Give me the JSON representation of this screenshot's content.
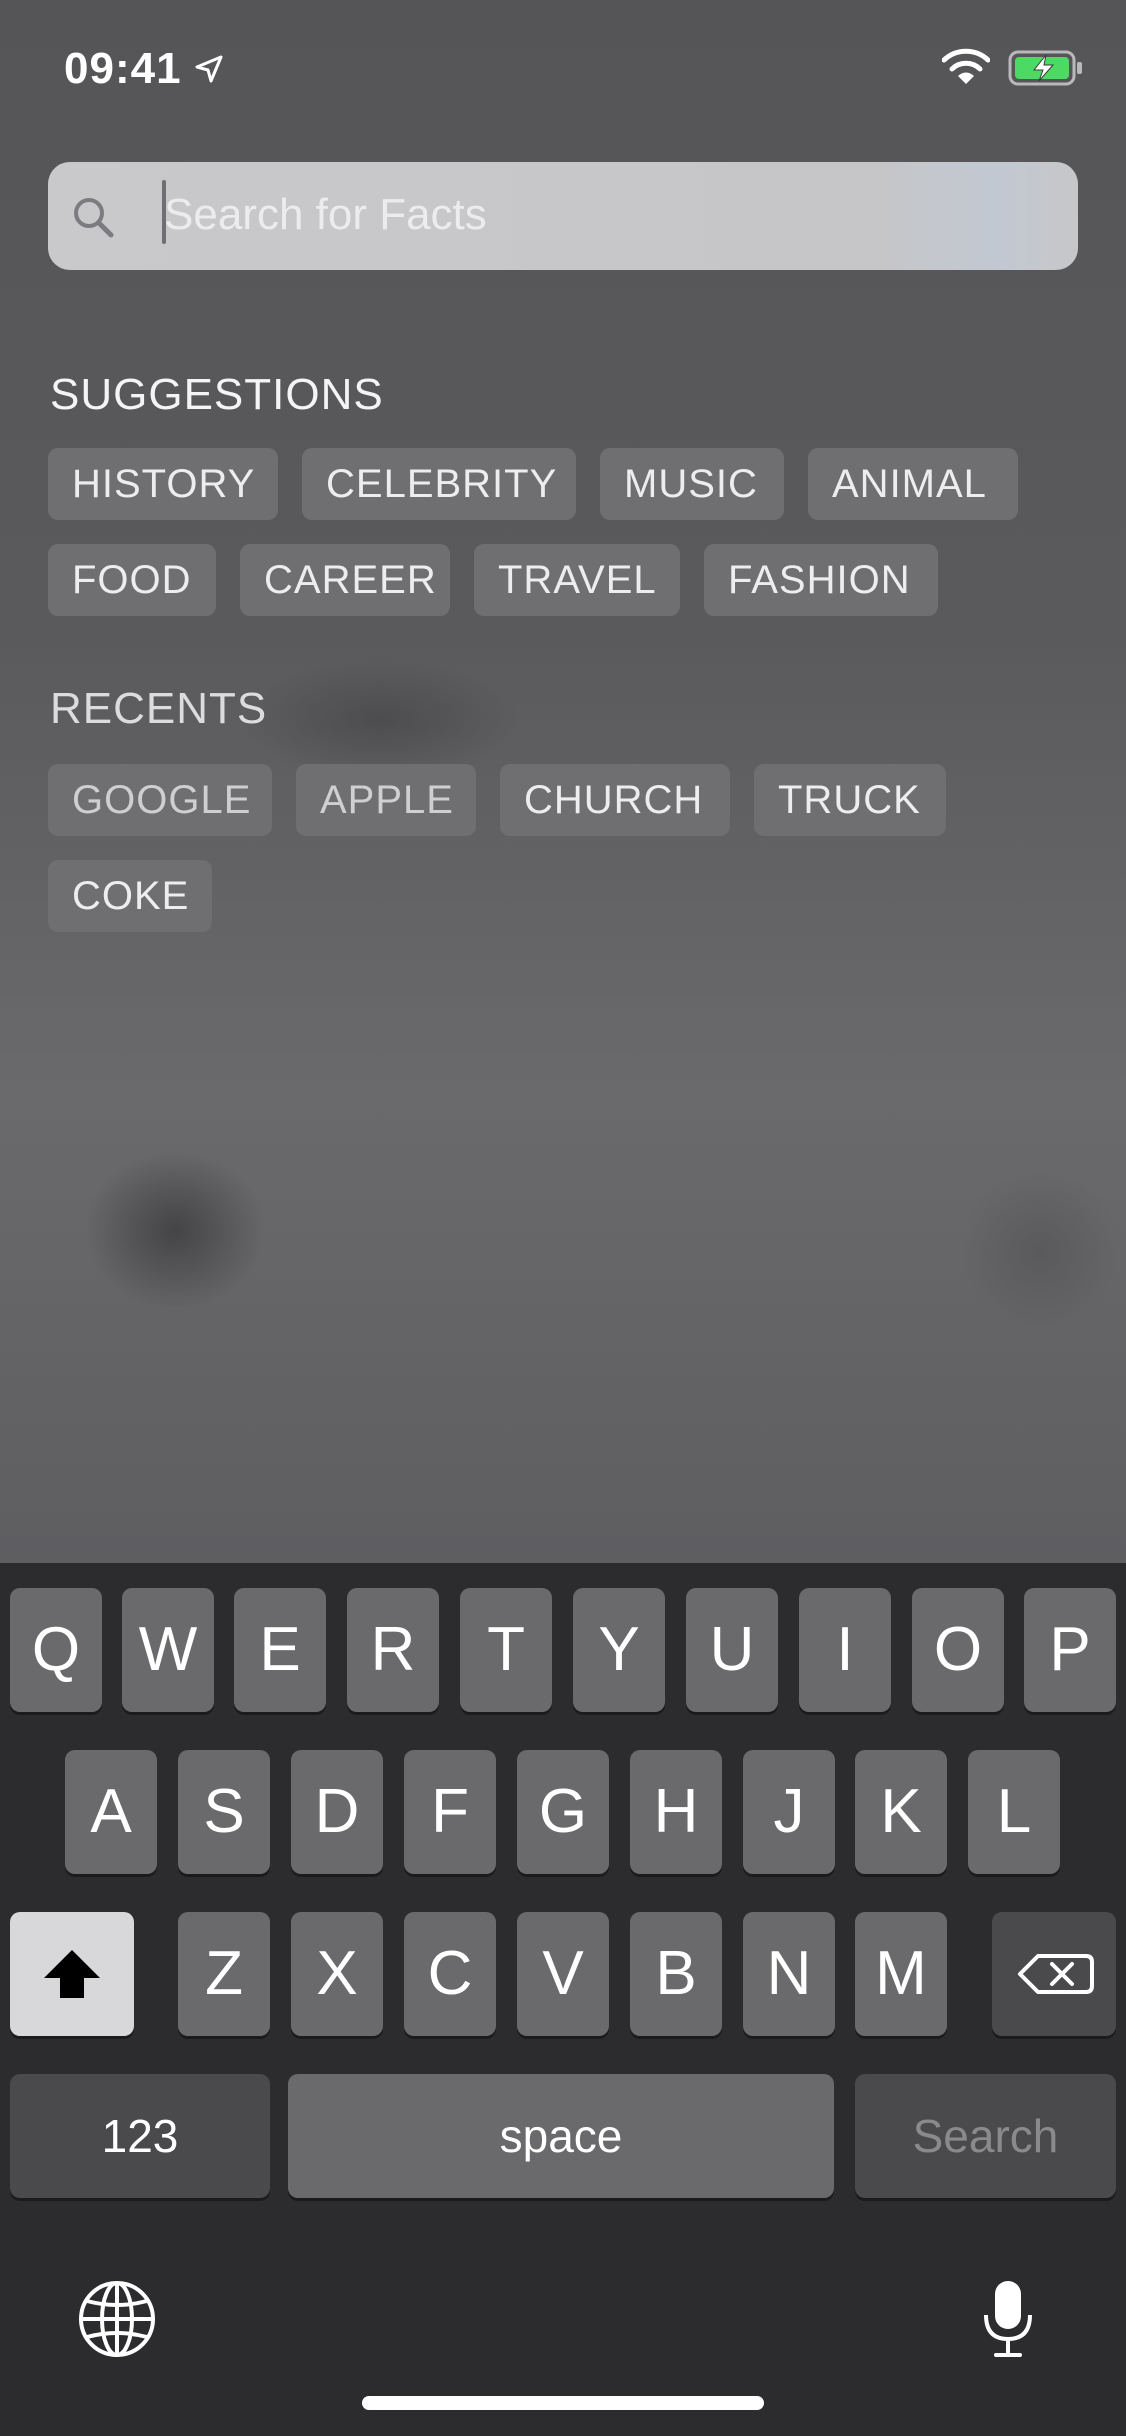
{
  "status_bar": {
    "time": "09:41"
  },
  "search": {
    "placeholder": "Search for Facts",
    "value": ""
  },
  "suggestions": {
    "title": "SUGGESTIONS",
    "items": [
      "HISTORY",
      "CELEBRITY",
      "MUSIC",
      "ANIMAL",
      "FOOD",
      "CAREER",
      "TRAVEL",
      "FASHION"
    ]
  },
  "recents": {
    "title": "RECENTS",
    "items": [
      "GOOGLE",
      "APPLE",
      "CHURCH",
      "TRUCK",
      "COKE"
    ]
  },
  "keyboard": {
    "row1": [
      "Q",
      "W",
      "E",
      "R",
      "T",
      "Y",
      "U",
      "I",
      "O",
      "P"
    ],
    "row2": [
      "A",
      "S",
      "D",
      "F",
      "G",
      "H",
      "J",
      "K",
      "L"
    ],
    "row3": [
      "Z",
      "X",
      "C",
      "V",
      "B",
      "N",
      "M"
    ],
    "numbers_label": "123",
    "space_label": "space",
    "search_label": "Search",
    "icons": [
      "shift-icon",
      "delete-icon",
      "globe-icon",
      "microphone-icon"
    ]
  },
  "colors": {
    "battery_fill": "#4cd964",
    "background": "#5c5c5f",
    "keyboard_bg": "#2c2c2e"
  }
}
